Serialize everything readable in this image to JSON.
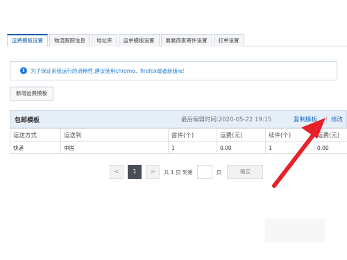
{
  "tabs": [
    {
      "label": "运费模板设置",
      "active": true
    },
    {
      "label": "物流跟踪信息"
    },
    {
      "label": "地址库"
    },
    {
      "label": "运单模板设置"
    },
    {
      "label": "襄襄商家寄件设置"
    },
    {
      "label": "打单设置"
    }
  ],
  "notice": {
    "icon": "info-icon",
    "text": "为了保证系统运行的流畅性,建议使用chrome、firefox或者新版ie!"
  },
  "new_template_button": "新增运费模板",
  "template": {
    "title": "包邮模板",
    "last_edited": "最后编辑时间:2020-05-22 19:15",
    "copy_label": "复制模板",
    "separator": "|",
    "edit_label": "修改",
    "columns": [
      "运送方式",
      "运送到",
      "首件(个)",
      "运费(元)",
      "续件(个)",
      "运费(元)"
    ],
    "rows": [
      [
        "快递",
        "中国",
        "1",
        "0.00",
        "1",
        "0.00"
      ]
    ]
  },
  "pagination": {
    "prev": "<",
    "current": "1",
    "next": ">",
    "total_text": "共 1 页 到第",
    "page_suffix": "页",
    "confirm": "确定"
  },
  "colors": {
    "accent": "#1a5fb0",
    "link": "#1a6fc4",
    "notice_text": "#1a7ed6",
    "arrow": "#e8202a"
  }
}
